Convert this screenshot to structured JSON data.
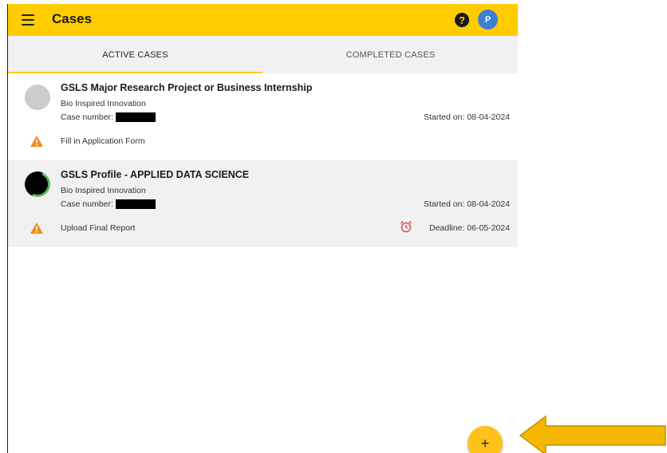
{
  "header": {
    "title": "Cases",
    "help_glyph": "?",
    "avatar_initial": "P",
    "menu_icon": "hamburger-icon",
    "accent_color": "#ffcc00"
  },
  "tabs": [
    {
      "label": "ACTIVE CASES",
      "active": true
    },
    {
      "label": "COMPLETED CASES",
      "active": false
    }
  ],
  "cases": [
    {
      "title": "GSLS Major Research Project or Business Internship",
      "subtitle": "Bio Inspired Innovation",
      "case_number_label": "Case number:",
      "started": "Started on: 08-04-2024",
      "task": "Fill in Application Form",
      "deadline": ""
    },
    {
      "title": "GSLS Profile - APPLIED DATA SCIENCE",
      "subtitle": "Bio Inspired Innovation",
      "case_number_label": "Case number:",
      "started": "Started on: 08-04-2024",
      "task": "Upload Final Report",
      "deadline": "Deadline: 06-05-2024"
    }
  ],
  "fab": {
    "label": "+"
  },
  "colors": {
    "warning": "#f08c1a",
    "alarm": "#d9534f",
    "progress": "#5cb85c",
    "arrow": "#f5b800"
  }
}
